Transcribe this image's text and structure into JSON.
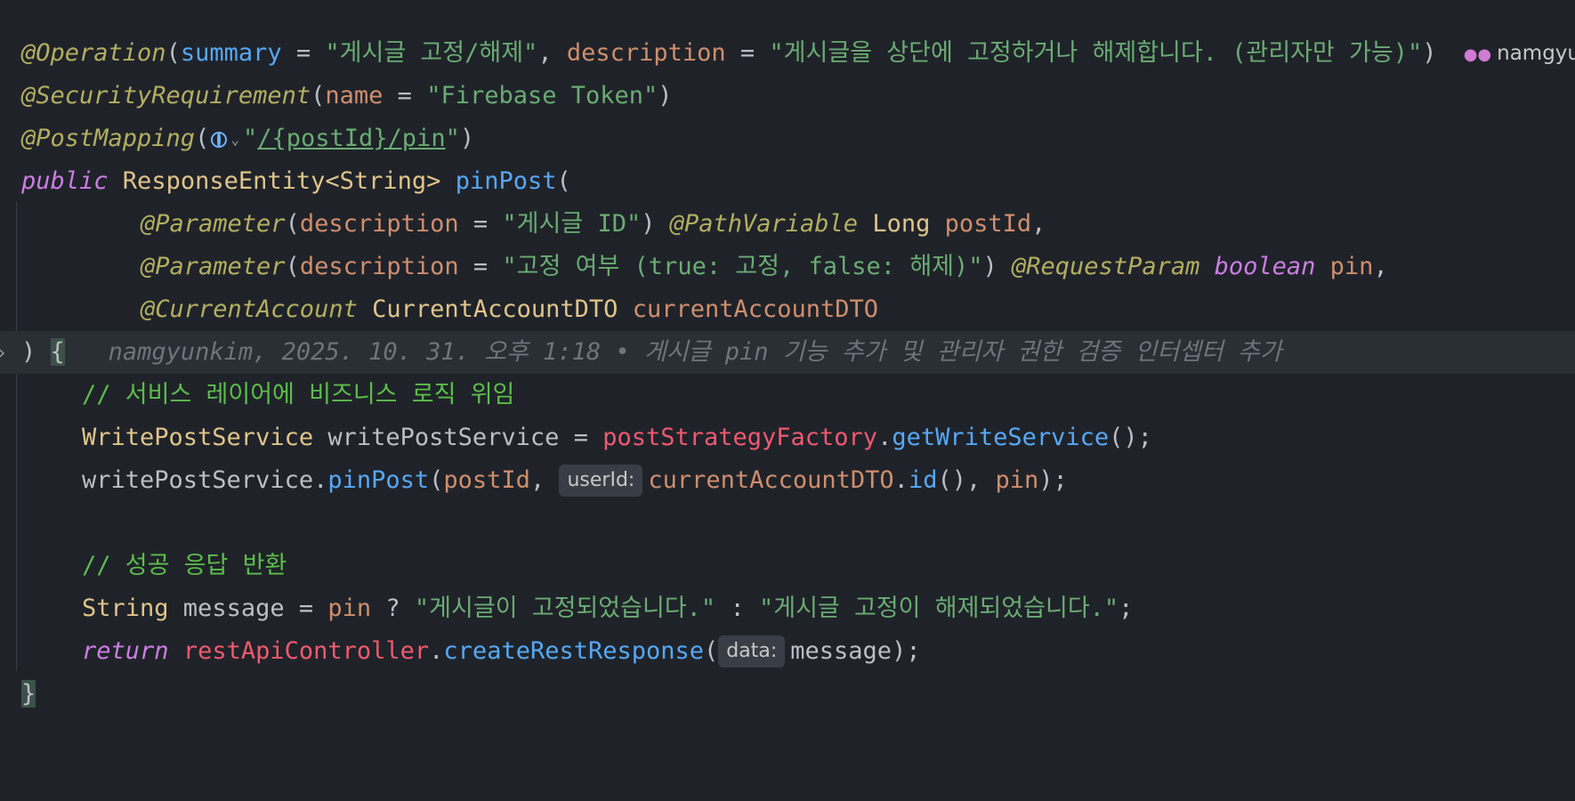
{
  "blame_author": "namgyu",
  "line1": {
    "ann": "@Operation",
    "open": "(",
    "k1": "summary",
    "eq1": " = ",
    "v1": "\"게시글 고정/해제\"",
    "comma": ", ",
    "k2": "description",
    "eq2": " = ",
    "v2": "\"게시글을 상단에 고정하거나 해제합니다. (관리자만 가능)\"",
    "close": ")"
  },
  "line2": {
    "ann": "@SecurityRequirement",
    "open": "(",
    "k1": "name",
    "eq1": " = ",
    "v1": "\"Firebase Token\"",
    "close": ")"
  },
  "line3": {
    "ann": "@PostMapping",
    "open": "(",
    "q1": "\"",
    "path": "/{postId}/pin",
    "q2": "\"",
    "close": ")"
  },
  "line4": {
    "kw": "public",
    "type": " ResponseEntity<String> ",
    "fn": "pinPost",
    "open": "("
  },
  "line5": {
    "ann": "@Parameter",
    "open": "(",
    "k": "description",
    "eq": " = ",
    "v": "\"게시글 ID\"",
    "close": ") ",
    "ann2": "@PathVariable",
    "type": " Long ",
    "param": "postId",
    "end": ","
  },
  "line6": {
    "ann": "@Parameter",
    "open": "(",
    "k": "description",
    "eq": " = ",
    "v": "\"고정 여부 (true: 고정, false: 해제)\"",
    "close": ") ",
    "ann2": "@RequestParam",
    "kw": " boolean",
    "param": " pin",
    "end": ","
  },
  "line7": {
    "ann": "@CurrentAccount",
    "type": " CurrentAccountDTO ",
    "param": "currentAccountDTO"
  },
  "line8": {
    "close": ") ",
    "brace": "{",
    "blame_who": "namgyunkim, 2025. 10. 31. 오후 1:18",
    "bullet": " • ",
    "blame_msg1": "게시글 ",
    "blame_msg2": "pin",
    "blame_msg3": " 기능 추가 및 관리자 권한 검증 인터셉터 추가"
  },
  "line9": {
    "comment": "// 서비스 레이어에 비즈니스 로직 위임"
  },
  "line10": {
    "type": "WritePostService",
    "var": " writePostService = ",
    "field": "postStrategyFactory",
    "dot": ".",
    "fn": "getWriteService",
    "end": "();"
  },
  "line11": {
    "var": "writePostService.",
    "fn": "pinPost",
    "open": "(",
    "p1": "postId",
    "comma": ", ",
    "hint": "userId:",
    "p2": "currentAccountDTO",
    "dot": ".",
    "fn2": "id",
    "mid": "(), ",
    "p3": "pin",
    "end": ");"
  },
  "line13": {
    "comment": "// 성공 응답 반환"
  },
  "line14": {
    "type": "String",
    "var": " message = ",
    "p": "pin",
    "tern": " ? ",
    "s1": "\"게시글이 고정되었습니다.\"",
    "colon": " : ",
    "s2": "\"게시글 고정이 해제되었습니다.\"",
    "end": ";"
  },
  "line15": {
    "kw": "return",
    "sp": " ",
    "field": "restApiController",
    "dot": ".",
    "fn": "createRestResponse",
    "open": "(",
    "hint": "data:",
    "arg": "message",
    "end": ");"
  },
  "line16": {
    "brace": "}"
  }
}
